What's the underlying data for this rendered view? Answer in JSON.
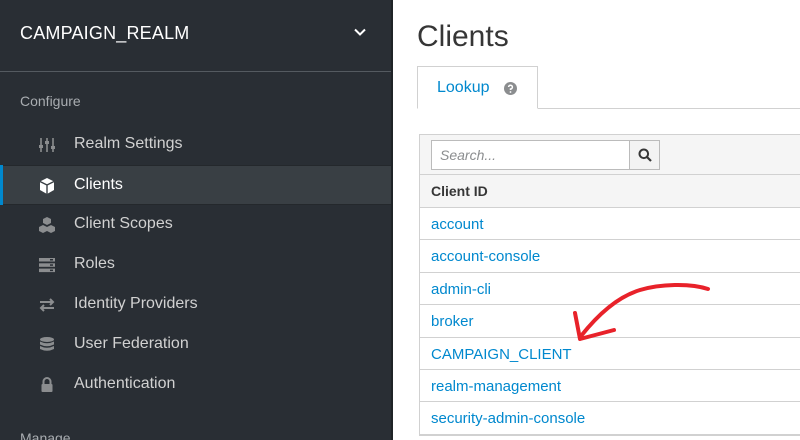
{
  "sidebar": {
    "realm": "CAMPAIGN_REALM",
    "configure_label": "Configure",
    "manage_label": "Manage",
    "items": [
      {
        "label": "Realm Settings",
        "icon": "sliders-icon"
      },
      {
        "label": "Clients",
        "icon": "cube-icon",
        "active": true
      },
      {
        "label": "Client Scopes",
        "icon": "cubes-icon"
      },
      {
        "label": "Roles",
        "icon": "list-icon"
      },
      {
        "label": "Identity Providers",
        "icon": "exchange-icon"
      },
      {
        "label": "User Federation",
        "icon": "database-icon"
      },
      {
        "label": "Authentication",
        "icon": "lock-icon"
      }
    ]
  },
  "main": {
    "title": "Clients",
    "tab_label": "Lookup",
    "search_placeholder": "Search...",
    "column_header": "Client ID",
    "clients": [
      "account",
      "account-console",
      "admin-cli",
      "broker",
      "CAMPAIGN_CLIENT",
      "realm-management",
      "security-admin-console"
    ]
  },
  "colors": {
    "sidebar_bg": "#292e34",
    "active_accent": "#0088ce",
    "link": "#0088ce",
    "annotation_arrow": "#e8222a"
  }
}
